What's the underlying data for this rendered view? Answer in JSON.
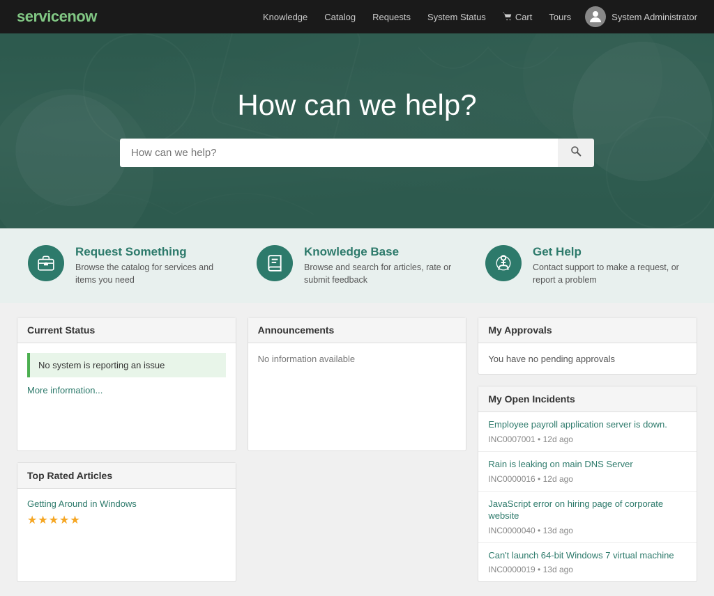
{
  "navbar": {
    "logo": "servicenow",
    "links": [
      {
        "label": "Knowledge",
        "id": "knowledge"
      },
      {
        "label": "Catalog",
        "id": "catalog"
      },
      {
        "label": "Requests",
        "id": "requests"
      },
      {
        "label": "System Status",
        "id": "system-status"
      },
      {
        "label": "Cart",
        "id": "cart"
      },
      {
        "label": "Tours",
        "id": "tours"
      }
    ],
    "cart_label": "Cart",
    "user_label": "System Administrator"
  },
  "hero": {
    "title": "How can we help?",
    "search_placeholder": "How can we help?"
  },
  "features": [
    {
      "id": "request",
      "icon": "briefcase",
      "title": "Request Something",
      "description": "Browse the catalog for services and items you need"
    },
    {
      "id": "knowledge",
      "icon": "book",
      "title": "Knowledge Base",
      "description": "Browse and search for articles, rate or submit feedback"
    },
    {
      "id": "help",
      "icon": "person",
      "title": "Get Help",
      "description": "Contact support to make a request, or report a problem"
    }
  ],
  "current_status": {
    "header": "Current Status",
    "status_message": "No system is reporting an issue",
    "more_link": "More information..."
  },
  "top_articles": {
    "header": "Top Rated Articles",
    "articles": [
      {
        "title": "Getting Around in Windows",
        "stars": 5
      }
    ]
  },
  "announcements": {
    "header": "Announcements",
    "message": "No information available"
  },
  "approvals": {
    "header": "My Approvals",
    "message": "You have no pending approvals"
  },
  "incidents": {
    "header": "My Open Incidents",
    "items": [
      {
        "title": "Employee payroll application server is down.",
        "id": "INC0007001",
        "ago": "12d ago"
      },
      {
        "title": "Rain is leaking on main DNS Server",
        "id": "INC0000016",
        "ago": "12d ago"
      },
      {
        "title": "JavaScript error on hiring page of corporate website",
        "id": "INC0000040",
        "ago": "13d ago"
      },
      {
        "title": "Can't launch 64-bit Windows 7 virtual machine",
        "id": "INC0000019",
        "ago": "13d ago"
      }
    ]
  }
}
